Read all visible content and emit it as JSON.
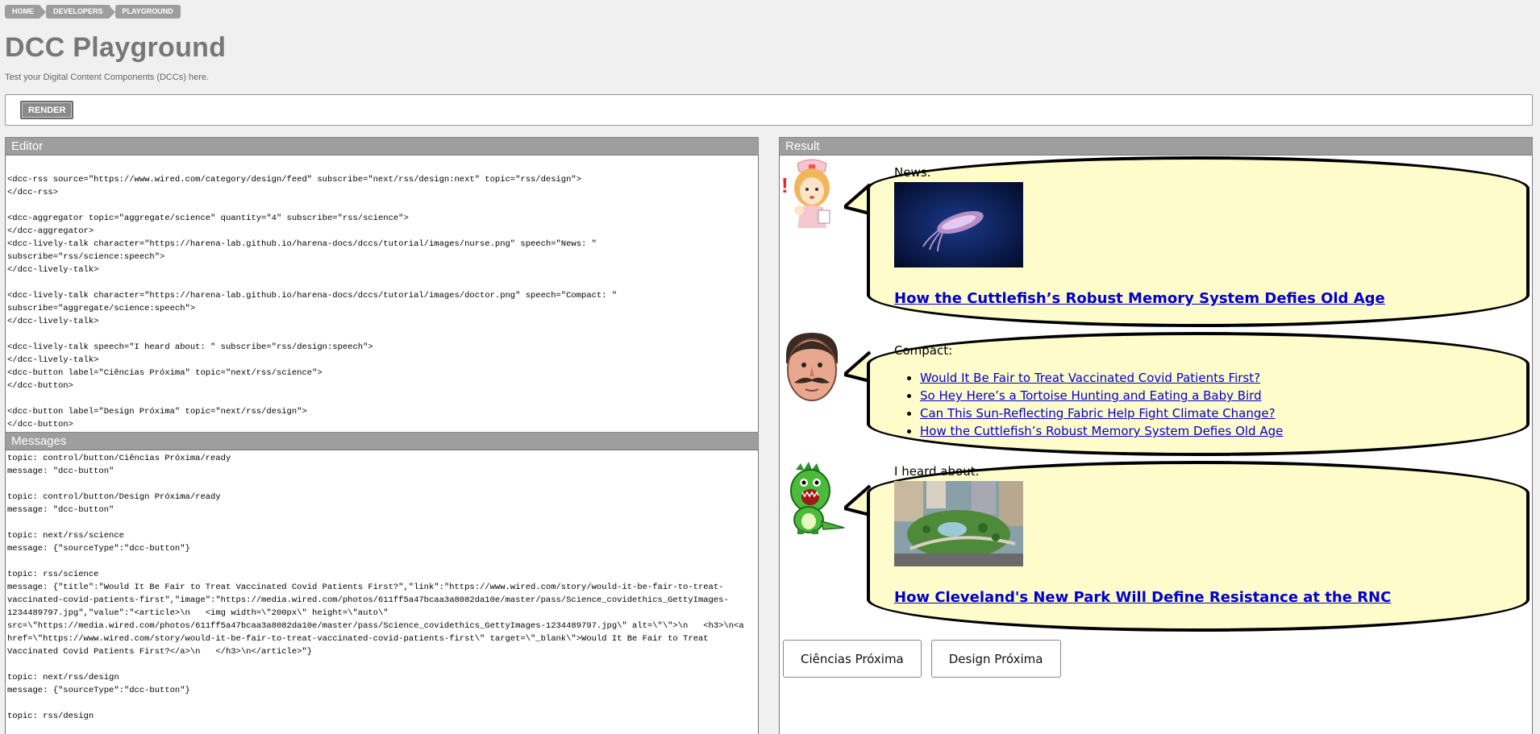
{
  "breadcrumb": [
    "HOME",
    "DEVELOPERS",
    "PLAYGROUND"
  ],
  "page": {
    "title": "DCC Playground",
    "subtitle": "Test your Digital Content Components (DCCs) here."
  },
  "toolbar": {
    "render_label": "RENDER"
  },
  "editor": {
    "header": "Editor",
    "code": "<dcc-rss source=\"https://www.wired.com/category/design/feed\" subscribe=\"next/rss/design:next\" topic=\"rss/design\">\n</dcc-rss>\n\n<dcc-aggregator topic=\"aggregate/science\" quantity=\"4\" subscribe=\"rss/science\">\n</dcc-aggregator>\n<dcc-lively-talk character=\"https://harena-lab.github.io/harena-docs/dccs/tutorial/images/nurse.png\" speech=\"News: \"\nsubscribe=\"rss/science:speech\">\n</dcc-lively-talk>\n\n<dcc-lively-talk character=\"https://harena-lab.github.io/harena-docs/dccs/tutorial/images/doctor.png\" speech=\"Compact: \"\nsubscribe=\"aggregate/science:speech\">\n</dcc-lively-talk>\n\n<dcc-lively-talk speech=\"I heard about: \" subscribe=\"rss/design:speech\">\n</dcc-lively-talk>\n<dcc-button label=\"Ciências Próxima\" topic=\"next/rss/science\">\n</dcc-button>\n\n<dcc-button label=\"Design Próxima\" topic=\"next/rss/design\">\n</dcc-button>"
  },
  "messages": {
    "header": "Messages",
    "log": "topic: control/button/Ciências Próxima/ready\nmessage: \"dcc-button\"\n\ntopic: control/button/Design Próxima/ready\nmessage: \"dcc-button\"\n\ntopic: next/rss/science\nmessage: {\"sourceType\":\"dcc-button\"}\n\ntopic: rss/science\nmessage: {\"title\":\"Would It Be Fair to Treat Vaccinated Covid Patients First?\",\"link\":\"https://www.wired.com/story/would-it-be-fair-to-treat-vaccinated-covid-patients-first\",\"image\":\"https://media.wired.com/photos/611ff5a47bcaa3a8082da10e/master/pass/Science_covidethics_GettyImages-1234489797.jpg\",\"value\":\"<article>\\n   <img width=\\\"200px\\\" height=\\\"auto\\\" src=\\\"https://media.wired.com/photos/611ff5a47bcaa3a8082da10e/master/pass/Science_covidethics_GettyImages-1234489797.jpg\\\" alt=\\\"\\\">\\n   <h3>\\n<a href=\\\"https://www.wired.com/story/would-it-be-fair-to-treat-vaccinated-covid-patients-first\\\" target=\\\"_blank\\\">Would It Be Fair to Treat Vaccinated Covid Patients First?</a>\\n   </h3>\\n</article>\"}\n\ntopic: next/rss/design\nmessage: {\"sourceType\":\"dcc-button\"}\n\ntopic: rss/design"
  },
  "result": {
    "header": "Result",
    "talks": [
      {
        "character": "nurse-icon",
        "speech": "News:",
        "link": "How the Cuttlefish’s Robust Memory System Defies Old Age"
      },
      {
        "character": "doctor-icon",
        "speech": "Compact:",
        "items": [
          "Would It Be Fair to Treat Vaccinated Covid Patients First?",
          "So Hey Here’s a Tortoise Hunting and Eating a Baby Bird",
          "Can This Sun-Reflecting Fabric Help Fight Climate Change?",
          "How the Cuttlefish’s Robust Memory System Defies Old Age"
        ]
      },
      {
        "character": "dinosaur-icon",
        "speech": "I heard about:",
        "link": "How Cleveland's New Park Will Define Resistance at the RNC"
      }
    ],
    "buttons": [
      "Ciências Próxima",
      "Design Próxima"
    ]
  },
  "colors": {
    "bubble_fill": "#fffccb",
    "link": "#0000cc",
    "header": "#9e9e9e"
  }
}
